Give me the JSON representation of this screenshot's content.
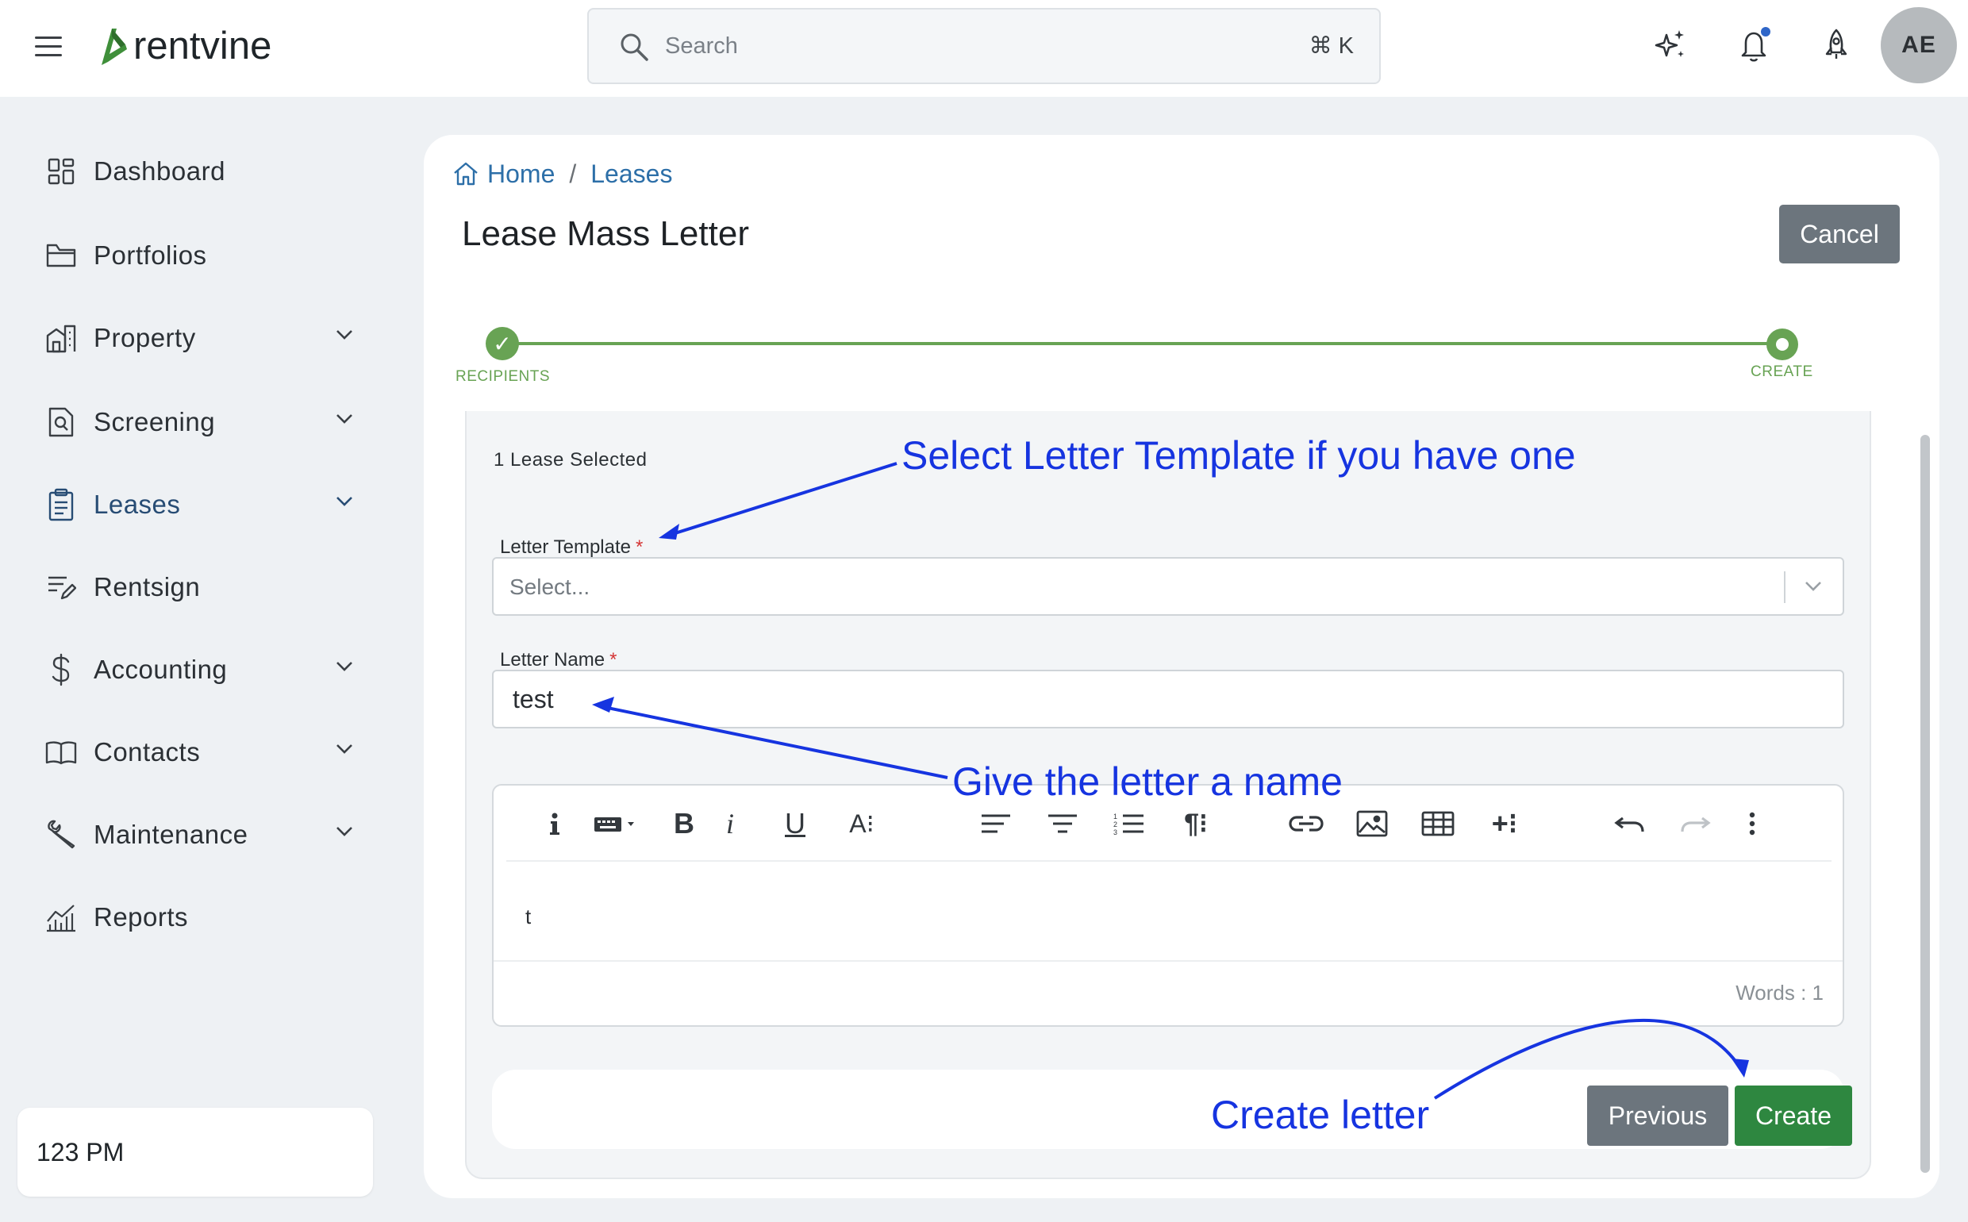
{
  "app": {
    "brand": "rentvine",
    "search_placeholder": "Search",
    "search_shortcut": "⌘ K",
    "avatar_initials": "AE",
    "accent": "#68a354",
    "link_color": "#2d6fa8"
  },
  "sidebar": {
    "items": [
      {
        "label": "Dashboard",
        "icon": "grid-icon"
      },
      {
        "label": "Portfolios",
        "icon": "folder-icon"
      },
      {
        "label": "Property",
        "icon": "building-icon"
      },
      {
        "label": "Screening",
        "icon": "document-search-icon"
      },
      {
        "label": "Leases",
        "icon": "clipboard-icon"
      },
      {
        "label": "Rentsign",
        "icon": "sign-pen-icon"
      },
      {
        "label": "Accounting",
        "icon": "dollar-icon"
      },
      {
        "label": "Contacts",
        "icon": "book-icon"
      },
      {
        "label": "Maintenance",
        "icon": "wrench-icon"
      },
      {
        "label": "Reports",
        "icon": "chart-icon"
      }
    ],
    "org_name": "123 PM"
  },
  "page": {
    "breadcrumb": {
      "home": "Home",
      "separator": "/",
      "current": "Leases"
    },
    "title": "Lease Mass Letter",
    "cancel_label": "Cancel",
    "steps": {
      "first": "RECIPIENTS",
      "second": "CREATE"
    }
  },
  "form": {
    "lease_count": "1 Lease Selected",
    "template_label": "Letter Template",
    "required_mark": "*",
    "template_placeholder": "Select...",
    "name_label": "Letter Name",
    "name_value": "test",
    "editor_text": "t",
    "word_count": "Words : 1",
    "previous_label": "Previous",
    "create_label": "Create"
  },
  "annotations": {
    "template_hint": "Select Letter Template if you have one",
    "name_hint": "Give the letter a name",
    "create_hint": "Create letter",
    "color": "#1634e0"
  }
}
